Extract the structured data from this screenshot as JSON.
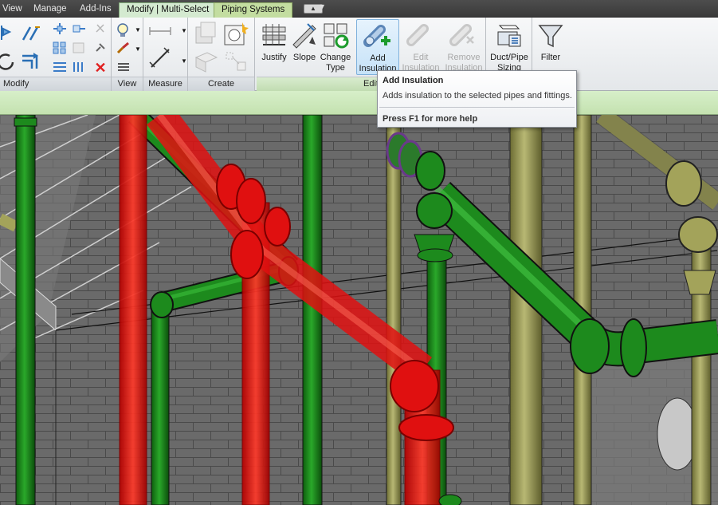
{
  "tabs": [
    {
      "label": "View"
    },
    {
      "label": "Manage"
    },
    {
      "label": "Add-Ins"
    },
    {
      "label": "Modify | Multi-Select"
    },
    {
      "label": "Piping Systems"
    }
  ],
  "panels": {
    "modify": "Modify",
    "view": "View",
    "measure": "Measure",
    "create": "Create",
    "edit": "Edit"
  },
  "buttons": {
    "justify": "Justify",
    "slope": "Slope",
    "change_type_1": "Change",
    "change_type_2": "Type",
    "add_insulation_1": "Add",
    "add_insulation_2": "Insulation",
    "edit_insulation_1": "Edit",
    "edit_insulation_2": "Insulation",
    "remove_insulation_1": "Remove",
    "remove_insulation_2": "Insulation",
    "duct_pipe_sizing_1": "Duct/Pipe",
    "duct_pipe_sizing_2": "Sizing",
    "filter": "Filter"
  },
  "tooltip": {
    "title": "Add Insulation",
    "description": "Adds insulation to the selected pipes and fittings.",
    "help": "Press F1 for more help"
  },
  "colors": {
    "selected_pipe": "#e01010",
    "pipe_green": "#1d8a1d",
    "pipe_olive": "#a3a35a",
    "background_wall": "#6b6b6b"
  }
}
